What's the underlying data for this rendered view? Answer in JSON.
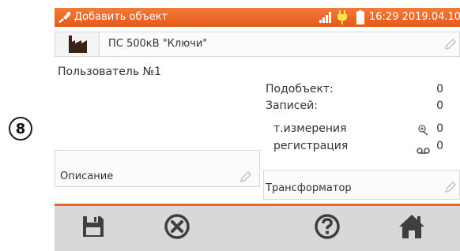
{
  "annotation": {
    "step_number": "8"
  },
  "statusbar": {
    "title": "Добавить объект",
    "time": "16:29 2019.04.10",
    "app_icon": "meter-probe-icon",
    "signal_icon": "signal-bars-icon",
    "power_icon": "power-plug-icon",
    "battery_icon": "battery-icon",
    "accent_color": "#f0651f"
  },
  "object": {
    "name": "ПС 500кВ \"Ключи\"",
    "icon": "factory-icon"
  },
  "user": "Пользователь №1",
  "stats": {
    "subobjects_label": "Подобъект:",
    "subobjects_value": "0",
    "records_label": "Записей:",
    "records_value": "0",
    "measurement_points_label": "т.измерения",
    "measurement_points_value": "0",
    "registration_label": "регистрация",
    "registration_value": "0"
  },
  "description": {
    "label": "Описание"
  },
  "transformer": {
    "label": "Трансформатор"
  },
  "toolbar": {
    "save_icon": "save-icon",
    "cancel_icon": "cancel-icon",
    "help_icon": "help-icon",
    "home_icon": "home-icon"
  }
}
